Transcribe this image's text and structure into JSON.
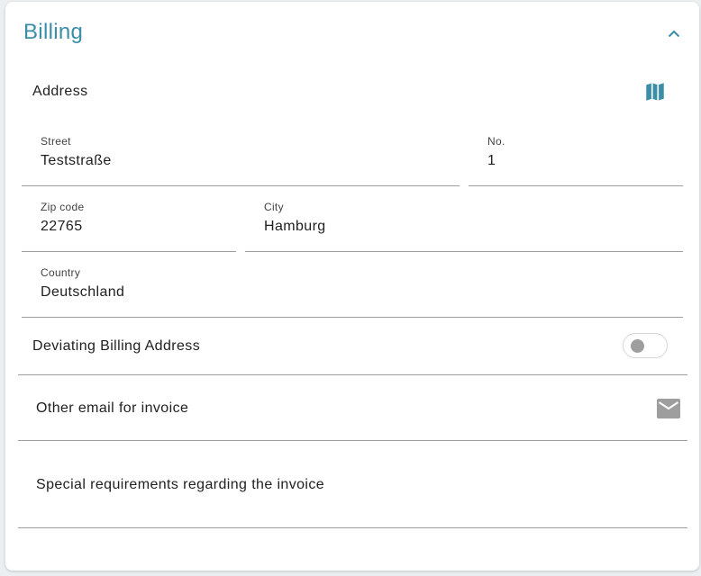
{
  "section": {
    "title": "Billing",
    "collapse_icon": "chevron-up-icon"
  },
  "address": {
    "label": "Address",
    "map_icon": "map-icon",
    "street": {
      "label": "Street",
      "value": "Teststraße"
    },
    "number": {
      "label": "No.",
      "value": "1"
    },
    "zip": {
      "label": "Zip code",
      "value": "22765"
    },
    "city": {
      "label": "City",
      "value": "Hamburg"
    },
    "country": {
      "label": "Country",
      "value": "Deutschland"
    }
  },
  "deviating_billing": {
    "label": "Deviating Billing Address",
    "enabled": false
  },
  "invoice_email": {
    "placeholder": "Other email for invoice",
    "icon": "mail-icon"
  },
  "special_requirements": {
    "placeholder": "Special requirements regarding the invoice"
  },
  "colors": {
    "accent": "#3a8ea8",
    "divider": "#9e9e9e",
    "icon_gray": "#9e9e9e"
  }
}
